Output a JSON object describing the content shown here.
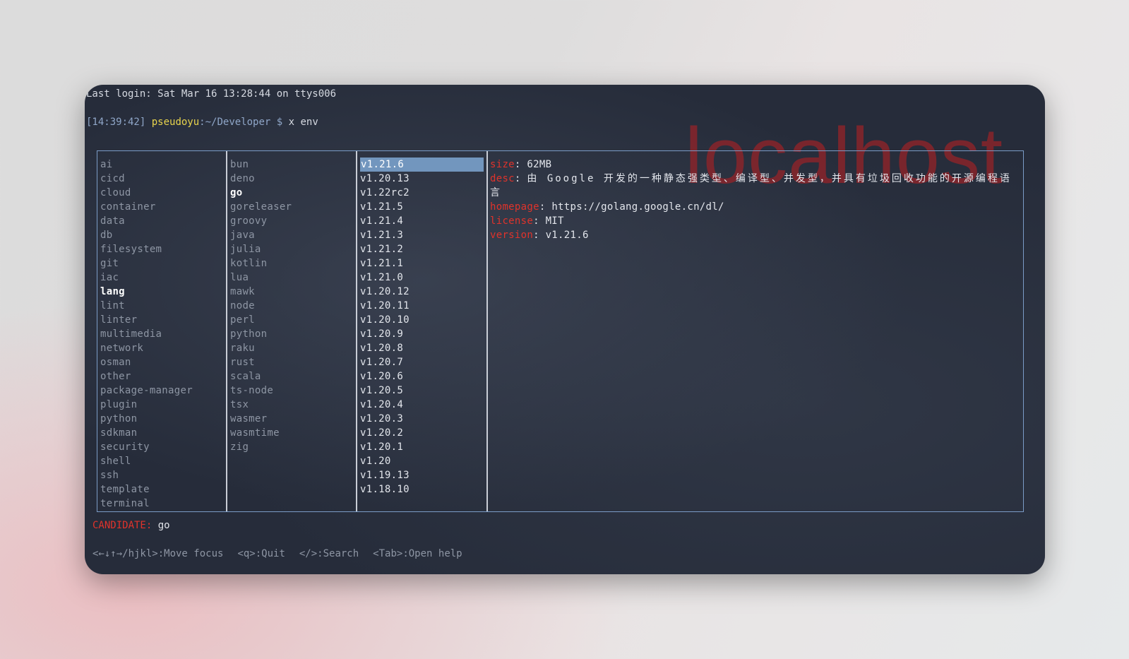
{
  "terminal": {
    "last_login": "Last login: Sat Mar 16 13:28:44 on ttys006",
    "prompt": {
      "time": "[14:39:42]",
      "user": "pseudoyu",
      "separator": ":",
      "path": "~/Developer $",
      "command": "x env"
    },
    "watermark": "localhost"
  },
  "categories": {
    "items": [
      "ai",
      "cicd",
      "cloud",
      "container",
      "data",
      "db",
      "filesystem",
      "git",
      "iac",
      "lang",
      "lint",
      "linter",
      "multimedia",
      "network",
      "osman",
      "other",
      "package-manager",
      "plugin",
      "python",
      "sdkman",
      "security",
      "shell",
      "ssh",
      "template",
      "terminal"
    ],
    "active": "lang"
  },
  "packages": {
    "items": [
      "bun",
      "deno",
      "go",
      "goreleaser",
      "groovy",
      "java",
      "julia",
      "kotlin",
      "lua",
      "mawk",
      "node",
      "perl",
      "python",
      "raku",
      "rust",
      "scala",
      "ts-node",
      "tsx",
      "wasmer",
      "wasmtime",
      "zig"
    ],
    "active": "go"
  },
  "versions": {
    "items": [
      "v1.21.6",
      "v1.20.13",
      "v1.22rc2",
      "v1.21.5",
      "v1.21.4",
      "v1.21.3",
      "v1.21.2",
      "v1.21.1",
      "v1.21.0",
      "v1.20.12",
      "v1.20.11",
      "v1.20.10",
      "v1.20.9",
      "v1.20.8",
      "v1.20.7",
      "v1.20.6",
      "v1.20.5",
      "v1.20.4",
      "v1.20.3",
      "v1.20.2",
      "v1.20.1",
      "v1.20",
      "v1.19.13",
      "v1.18.10"
    ],
    "selected": "v1.21.6"
  },
  "details": {
    "size_key": "size",
    "size_value": "62MB",
    "desc_key": "desc",
    "desc_value": "由 Google 开发的一种静态强类型、编译型、并发型，并具有垃圾回收功能的开源编程语言",
    "homepage_key": "homepage",
    "homepage_value": "https://golang.google.cn/dl/",
    "license_key": "license",
    "license_value": "MIT",
    "version_key": "version",
    "version_value": "v1.21.6"
  },
  "footer": {
    "candidate_label": "CANDIDATE:",
    "candidate_value": "go",
    "help": [
      "<←↓↑→/hjkl>:Move focus",
      "<q>:Quit",
      "</>:Search",
      "<Tab>:Open help"
    ]
  },
  "colors": {
    "accent_red": "#e0332b",
    "prompt_user": "#e8d44d",
    "selection": "#7296be",
    "frame_border": "#7b9cc7"
  }
}
